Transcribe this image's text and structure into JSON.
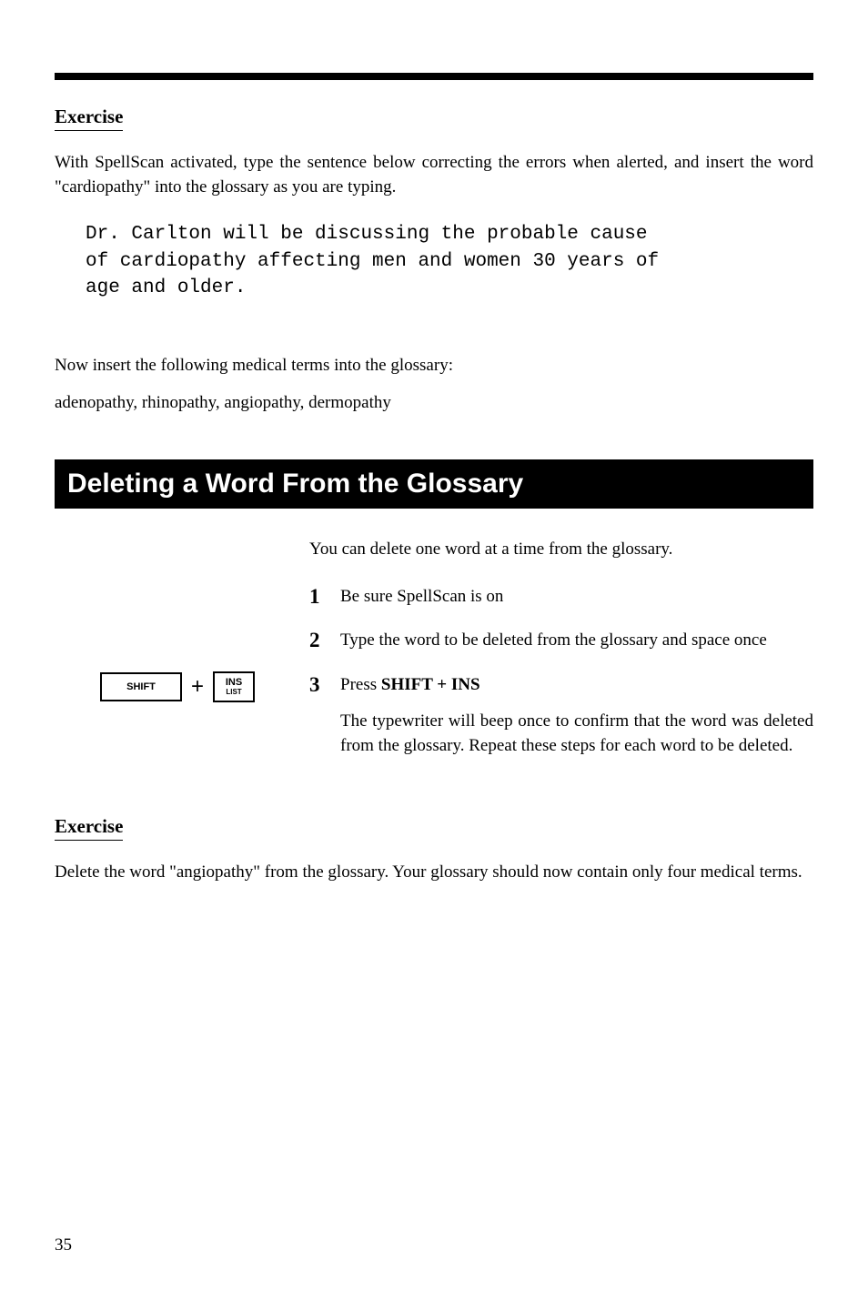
{
  "exercise1": {
    "heading": "Exercise",
    "intro": "With SpellScan activated, type the sentence below correcting the errors when alerted, and insert the word \"cardiopathy\" into the glossary as you are typing.",
    "mono": "Dr. Carlton will be discussing the probable cause\nof cardiopathy affecting men and women 30 years of\nage and older.",
    "followup1": "Now insert the following medical terms into the glossary:",
    "followup2": "adenopathy, rhinopathy, angiopathy, dermopathy"
  },
  "section": {
    "title": "Deleting a Word From the Glossary",
    "intro": "You can delete one word at a time from the glossary.",
    "steps": [
      {
        "num": "1",
        "text": "Be sure SpellScan is on"
      },
      {
        "num": "2",
        "text": "Type the word to be deleted from the glossary and space once"
      },
      {
        "num": "3",
        "prefix": "Press ",
        "boldpart": "SHIFT + INS",
        "extra": "The typewriter will beep once to confirm that the word was deleted from the glossary. Repeat these steps for each word to be deleted."
      }
    ],
    "keys": {
      "shift": "SHIFT",
      "plus": "+",
      "ins_top": "INS",
      "ins_bottom": "LIST"
    }
  },
  "exercise2": {
    "heading": "Exercise",
    "text": "Delete the word \"angiopathy\" from the glossary. Your glossary should now contain only four medical terms."
  },
  "page_number": "35"
}
